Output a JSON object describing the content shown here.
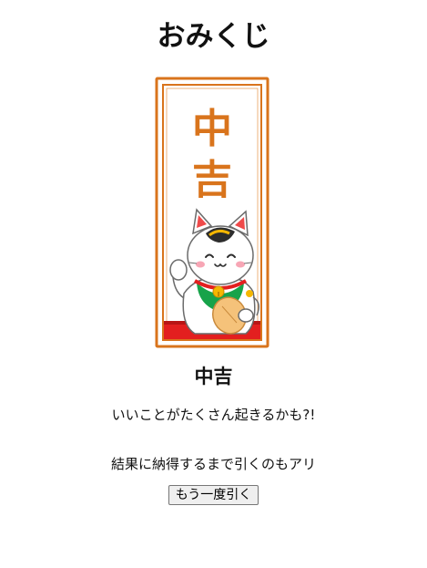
{
  "page": {
    "title": "おみくじ"
  },
  "omikuji_card": {
    "fortune_characters": [
      "中",
      "吉"
    ],
    "illustration": "maneki-neko holding koban coin",
    "colors": {
      "frame": "#d9741c",
      "text": "#d9741c",
      "base": "#e31f1f",
      "bib": "#17a34a",
      "coin": "#f5c27a"
    }
  },
  "result": {
    "fortune": "中吉",
    "message": "いいことがたくさん起きるかも?!",
    "note": "結果に納得するまで引くのもアリ"
  },
  "actions": {
    "retry_label": "もう一度引く"
  }
}
